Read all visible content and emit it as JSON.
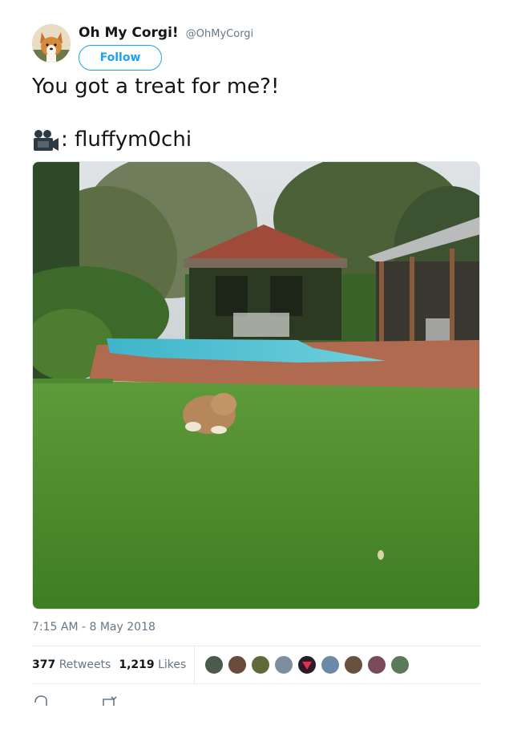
{
  "tweet": {
    "author": {
      "display_name": "Oh My Corgi!",
      "handle": "@OhMyCorgi",
      "avatar_icon": "corgi-avatar"
    },
    "follow_label": "Follow",
    "text": "You got a treat for me?!",
    "credit_icon": "video-camera-icon",
    "credit_text": ": fluffym0chi",
    "media_description_icon": "corgi-in-backyard-photo",
    "timestamp": "7:15 AM - 8 May 2018",
    "retweets_count": "377",
    "retweets_label": "Retweets",
    "likes_count": "1,219",
    "likes_label": "Likes",
    "liker_avatar_count": 9
  },
  "colors": {
    "accent": "#1da1f2",
    "secondary_text": "#657786",
    "divider": "#e6ecf0"
  }
}
